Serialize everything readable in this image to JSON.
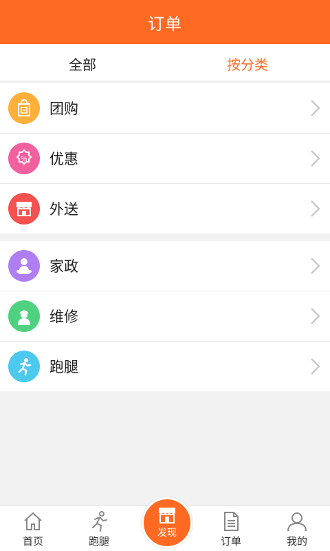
{
  "header": {
    "title": "订单"
  },
  "tabs": [
    {
      "label": "全部",
      "active": false
    },
    {
      "label": "按分类",
      "active": true
    }
  ],
  "groups": [
    [
      {
        "label": "团购",
        "icon": "shopping-bag-icon",
        "color": "#ffb03a"
      },
      {
        "label": "优惠",
        "icon": "discount-badge-icon",
        "color": "#f2609f"
      },
      {
        "label": "外送",
        "icon": "storefront-icon",
        "color": "#f55151"
      }
    ],
    [
      {
        "label": "家政",
        "icon": "housekeeper-icon",
        "color": "#b07ef3"
      },
      {
        "label": "维修",
        "icon": "repairman-icon",
        "color": "#4fd27f"
      },
      {
        "label": "跑腿",
        "icon": "runner-icon",
        "color": "#4cc9ef"
      }
    ]
  ],
  "bottom_nav": {
    "items": [
      {
        "label": "首页",
        "icon": "home-icon"
      },
      {
        "label": "跑腿",
        "icon": "runner-icon"
      },
      {
        "label": "订单",
        "icon": "document-icon"
      },
      {
        "label": "我的",
        "icon": "user-icon"
      }
    ],
    "center": {
      "label": "发现",
      "icon": "store-icon",
      "color": "#ff6a22"
    }
  },
  "colors": {
    "accent": "#ff6a22",
    "background": "#f2f2f2"
  }
}
